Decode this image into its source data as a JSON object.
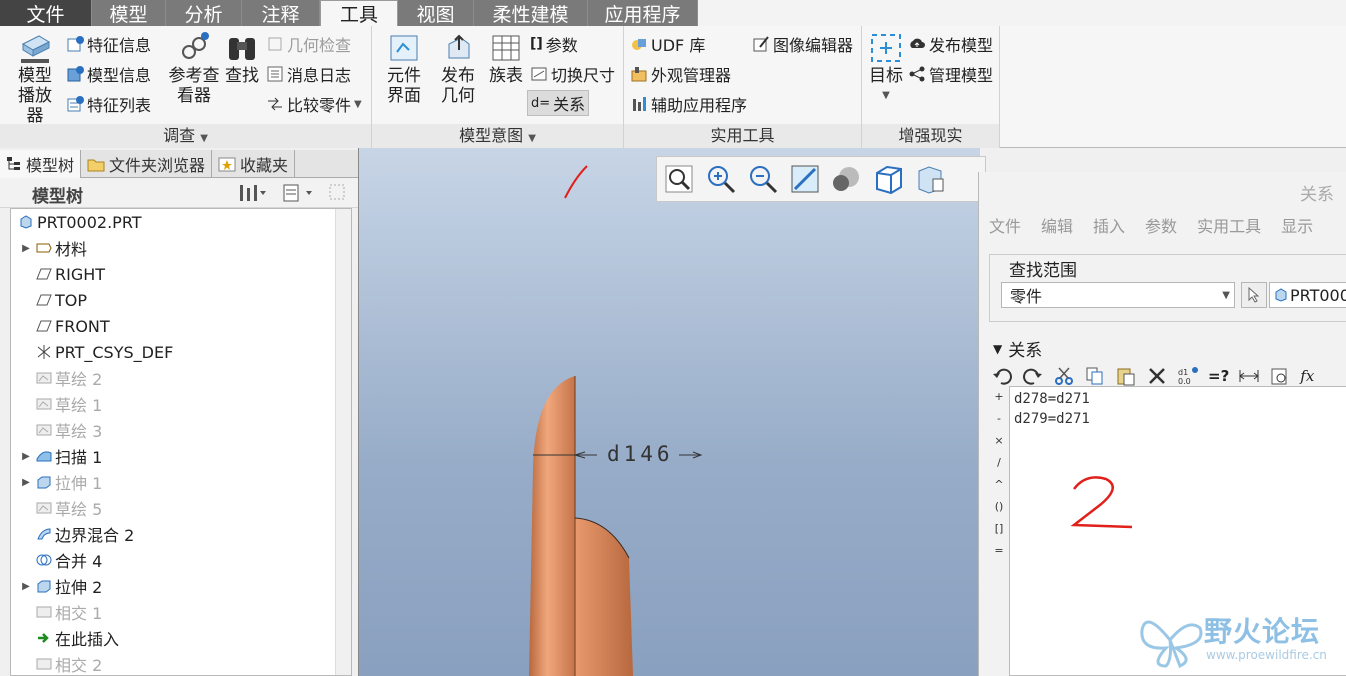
{
  "tabs": [
    "文件",
    "模型",
    "分析",
    "注释",
    "工具",
    "视图",
    "柔性建模",
    "应用程序"
  ],
  "active_tab": "工具",
  "ribbon": {
    "investigate": {
      "title": "调查",
      "model_player": "模型播放器",
      "feature_info": "特征信息",
      "model_info": "模型信息",
      "feature_list": "特征列表",
      "ref_viewer": "参考查看器",
      "find": "查找",
      "geometry_check": "几何检查",
      "message_log": "消息日志",
      "compare_part": "比较零件"
    },
    "model_intent": {
      "title": "模型意图",
      "component_interface": "元件界面",
      "publish_geometry": "发布几何",
      "family_table": "族表",
      "parameters": "参数",
      "switch_dimensions": "切换尺寸",
      "relations": "关系"
    },
    "utilities": {
      "title": "实用工具",
      "udf_library": "UDF 库",
      "appearance_manager": "外观管理器",
      "aux_apps": "辅助应用程序",
      "image_editor": "图像编辑器"
    },
    "ar": {
      "title": "增强现实",
      "target": "目标",
      "publish_model": "发布模型",
      "manage_model": "管理模型"
    }
  },
  "panel": {
    "tabs": [
      "模型树",
      "文件夹浏览器",
      "收藏夹"
    ],
    "tree_title": "模型树",
    "items": [
      {
        "label": "PRT0002.PRT",
        "icon": "part-icon",
        "gray": false,
        "expander": false,
        "indent": 0
      },
      {
        "label": "材料",
        "icon": "material-icon",
        "gray": false,
        "expander": true,
        "indent": 1
      },
      {
        "label": "RIGHT",
        "icon": "datum-plane-icon",
        "gray": false,
        "expander": false,
        "indent": 1
      },
      {
        "label": "TOP",
        "icon": "datum-plane-icon",
        "gray": false,
        "expander": false,
        "indent": 1
      },
      {
        "label": "FRONT",
        "icon": "datum-plane-icon",
        "gray": false,
        "expander": false,
        "indent": 1
      },
      {
        "label": "PRT_CSYS_DEF",
        "icon": "csys-icon",
        "gray": false,
        "expander": false,
        "indent": 1
      },
      {
        "label": "草绘 2",
        "icon": "sketch-icon",
        "gray": true,
        "expander": false,
        "indent": 1
      },
      {
        "label": "草绘 1",
        "icon": "sketch-icon",
        "gray": true,
        "expander": false,
        "indent": 1
      },
      {
        "label": "草绘 3",
        "icon": "sketch-icon",
        "gray": true,
        "expander": false,
        "indent": 1
      },
      {
        "label": "扫描 1",
        "icon": "sweep-icon",
        "gray": false,
        "expander": true,
        "indent": 1
      },
      {
        "label": "拉伸 1",
        "icon": "extrude-icon",
        "gray": true,
        "expander": true,
        "indent": 1
      },
      {
        "label": "草绘 5",
        "icon": "sketch-icon",
        "gray": true,
        "expander": false,
        "indent": 1
      },
      {
        "label": "边界混合 2",
        "icon": "blend-icon",
        "gray": false,
        "expander": false,
        "indent": 1
      },
      {
        "label": "合并 4",
        "icon": "merge-icon",
        "gray": false,
        "expander": false,
        "indent": 1
      },
      {
        "label": "拉伸 2",
        "icon": "extrude-icon",
        "gray": false,
        "expander": true,
        "indent": 1
      },
      {
        "label": "相交 1",
        "icon": "intersect-icon",
        "gray": true,
        "expander": false,
        "indent": 1
      },
      {
        "label": "在此插入",
        "icon": "insert-here-icon",
        "gray": false,
        "expander": false,
        "indent": 1
      },
      {
        "label": "相交 2",
        "icon": "intersect-icon",
        "gray": true,
        "expander": false,
        "indent": 1
      }
    ]
  },
  "viewport": {
    "dimension_label": "d146"
  },
  "dialog": {
    "title": "关系",
    "menu": [
      "文件",
      "编辑",
      "插入",
      "参数",
      "实用工具",
      "显示"
    ],
    "lookin_label": "查找范围",
    "lookin_value": "零件",
    "model_value": "PRT000",
    "relations_header": "关系",
    "gutter": [
      "+",
      "-",
      "×",
      "/",
      "^",
      "()",
      "[]",
      "="
    ],
    "lines": [
      "d278=d271",
      "d279=d271"
    ]
  },
  "annotations": {
    "mark_2": "2"
  },
  "watermark": {
    "name": "野火论坛",
    "url": "www.proewildfire.cn"
  },
  "colors": {
    "accent": "#2a8fd6",
    "part": "#d9875a",
    "annotation": "#e0201a"
  }
}
